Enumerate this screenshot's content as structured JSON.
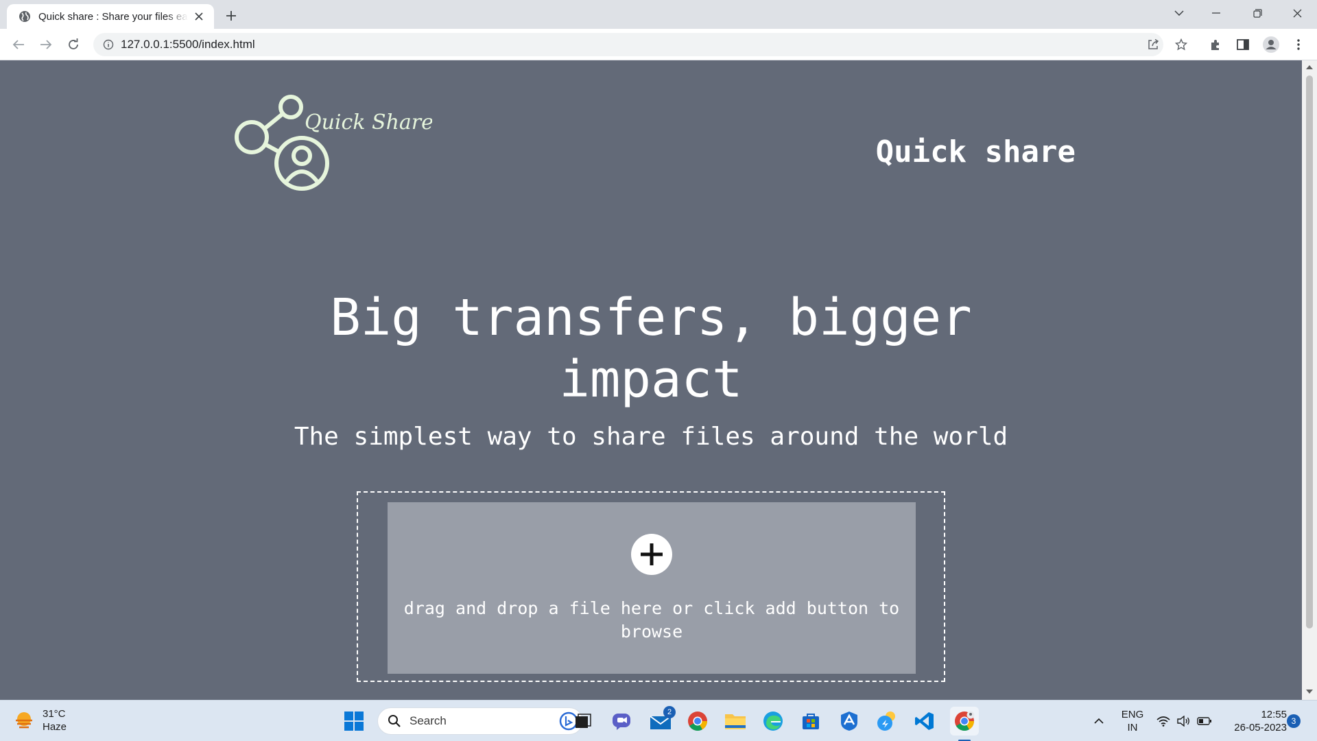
{
  "browser": {
    "tab_title": "Quick share : Share your files easily",
    "url": "127.0.0.1:5500/index.html"
  },
  "page": {
    "logo_text": "Quick Share",
    "nav_title": "Quick share",
    "hero_title": "Big transfers, bigger impact",
    "hero_subtitle": "The simplest way to share files around the world",
    "drop_text": "drag and drop a file here or click add button to browse"
  },
  "taskbar": {
    "weather_temp": "31°C",
    "weather_desc": "Haze",
    "search_label": "Search",
    "mail_badge": "2",
    "lang_line1": "ENG",
    "lang_line2": "IN",
    "time": "12:55",
    "date": "26-05-2023",
    "notification_count": "3"
  },
  "colors": {
    "page_background": "#636a78",
    "drop_area": "#999ea8",
    "logo": "#e6f5dc",
    "text": "#ffffff"
  }
}
